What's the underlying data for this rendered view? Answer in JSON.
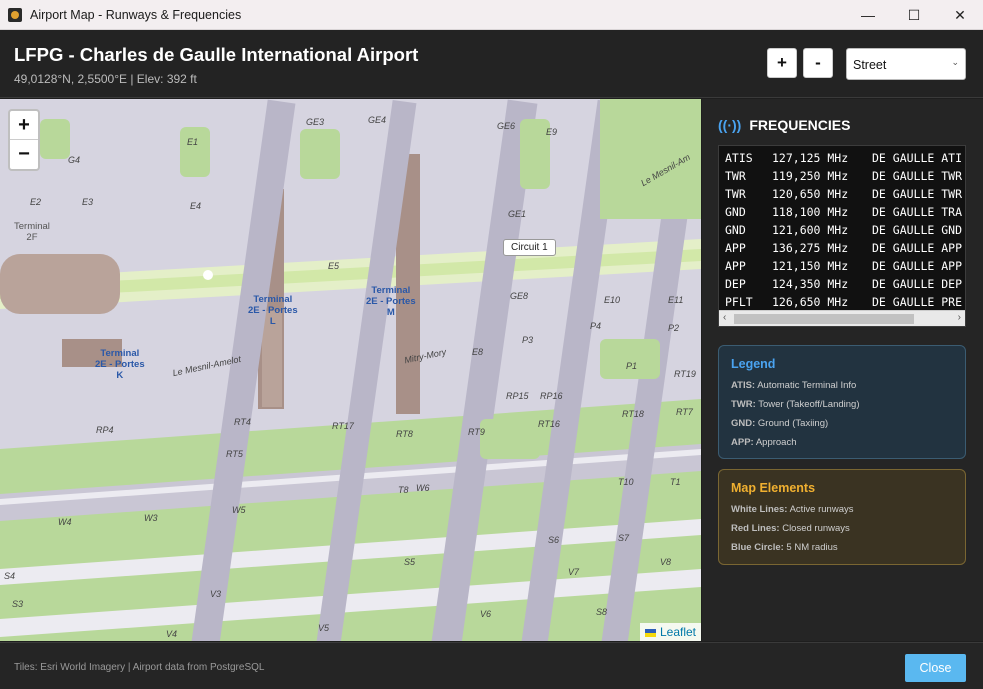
{
  "window": {
    "title": "Airport Map - Runways & Frequencies",
    "minimize": "—",
    "maximize": "☐",
    "close": "✕"
  },
  "header": {
    "title": "LFPG - Charles de Gaulle International Airport",
    "subtitle": "49,0128°N, 2,5500°E | Elev: 392 ft",
    "zoom_in": "+",
    "zoom_out": "-",
    "layer_select": "Street"
  },
  "map": {
    "zoom_in": "+",
    "zoom_out": "−",
    "attribution": "Leaflet",
    "labels": {
      "terminal_2f": "Terminal\n2F",
      "terminal_l": "Terminal\n2E - Portes\nL",
      "terminal_m": "Terminal\n2E - Portes\nM",
      "terminal_k": "Terminal\n2E - Portes\nK",
      "circuit": "Circuit 1",
      "road_amelot": "Le Mesnil-Amelot",
      "road_mory": "Mitry-Mory",
      "road_mesnil": "Le Mesnil-Am",
      "taxi": [
        "G4",
        "E3",
        "E2",
        "E4",
        "GE3",
        "GE4",
        "GE6",
        "E9",
        "E1",
        "GE1",
        "GE8",
        "P2",
        "P4",
        "P3",
        "E10",
        "E11",
        "E8",
        "E5",
        "RP15",
        "RP16",
        "RT16",
        "RT17",
        "RT18",
        "RT19",
        "RT9",
        "RT8",
        "RT7",
        "RT5",
        "RP4",
        "RT4",
        "W3",
        "W4",
        "W5",
        "W6",
        "T1",
        "T10",
        "T8",
        "S3",
        "S4",
        "S5",
        "S6",
        "S7",
        "S8",
        "V3",
        "V4",
        "V5",
        "V6",
        "V7",
        "V8",
        "P1"
      ]
    }
  },
  "frequencies": {
    "heading": "FREQUENCIES",
    "rows": [
      {
        "type": "ATIS",
        "mhz": "127,125 MHz",
        "name": "DE GAULLE ATI"
      },
      {
        "type": "TWR",
        "mhz": "119,250 MHz",
        "name": "DE GAULLE TWR"
      },
      {
        "type": "TWR",
        "mhz": "120,650 MHz",
        "name": "DE GAULLE TWR"
      },
      {
        "type": "GND",
        "mhz": "118,100 MHz",
        "name": "DE GAULLE TRA"
      },
      {
        "type": "GND",
        "mhz": "121,600 MHz",
        "name": "DE GAULLE GND"
      },
      {
        "type": "APP",
        "mhz": "136,275 MHz",
        "name": "DE GAULLE APP"
      },
      {
        "type": "APP",
        "mhz": "121,150 MHz",
        "name": "DE GAULLE APP"
      },
      {
        "type": "DEP",
        "mhz": "124,350 MHz",
        "name": "DE GAULLE DEP"
      },
      {
        "type": "PFLT",
        "mhz": "126,650 MHz",
        "name": "DE GAULLE PRE"
      }
    ]
  },
  "legend": {
    "title": "Legend",
    "items": [
      {
        "key": "ATIS:",
        "val": " Automatic Terminal Info"
      },
      {
        "key": "TWR:",
        "val": " Tower (Takeoff/Landing)"
      },
      {
        "key": "GND:",
        "val": " Ground (Taxiing)"
      },
      {
        "key": "APP:",
        "val": " Approach"
      }
    ]
  },
  "map_elements": {
    "title": "Map Elements",
    "items": [
      {
        "key": "White Lines:",
        "val": " Active runways"
      },
      {
        "key": "Red Lines:",
        "val": " Closed runways"
      },
      {
        "key": "Blue Circle:",
        "val": " 5 NM radius"
      }
    ]
  },
  "footer": {
    "source": "Tiles: Esri World Imagery | Airport data from PostgreSQL",
    "close": "Close"
  },
  "colors": {
    "accent": "#4aa3f0",
    "elements": "#f0b030",
    "close_button": "#5ab8f0"
  }
}
